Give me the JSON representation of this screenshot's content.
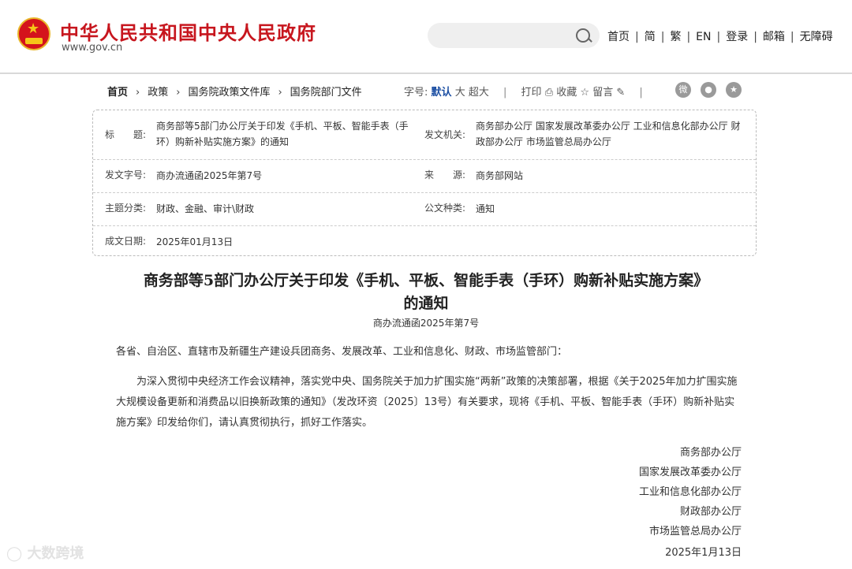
{
  "header": {
    "site_name": "中华人民共和国中央人民政府",
    "site_url": "www.gov.cn",
    "search_placeholder": "",
    "links": [
      "首页",
      "简",
      "繁",
      "EN",
      "登录",
      "邮箱",
      "无障碍"
    ]
  },
  "breadcrumb": [
    "首页",
    "政策",
    "国务院政策文件库",
    "国务院部门文件"
  ],
  "tools": {
    "font_label": "字号:",
    "font_default": "默认",
    "font_large": "大",
    "font_xlarge": "超大",
    "print": "打印",
    "collect": "收藏",
    "comment": "留言"
  },
  "info": {
    "title_label": "标　　题:",
    "title_value": "商务部等5部门办公厅关于印发《手机、平板、智能手表（手环）购新补贴实施方案》的通知",
    "issuer_label": "发文机关:",
    "issuer_value": "商务部办公厅  国家发展改革委办公厅  工业和信息化部办公厅  财政部办公厅  市场监管总局办公厅",
    "docno_label": "发文字号:",
    "docno_value": "商办流通函2025年第7号",
    "source_label": "来　　源:",
    "source_value": "商务部网站",
    "topic_label": "主题分类:",
    "topic_value": "财政、金融、审计\\财政",
    "type_label": "公文种类:",
    "type_value": "通知",
    "date_label": "成文日期:",
    "date_value": "2025年01月13日"
  },
  "document": {
    "title_line1": "商务部等5部门办公厅关于印发《手机、平板、智能手表（手环）购新补贴实施方案》",
    "title_line2": "的通知",
    "number": "商办流通函2025年第7号",
    "salutation": "各省、自治区、直辖市及新疆生产建设兵团商务、发展改革、工业和信息化、财政、市场监管部门：",
    "body": "为深入贯彻中央经济工作会议精神，落实党中央、国务院关于加力扩围实施“两新”政策的决策部署，根据《关于2025年加力扩围实施大规模设备更新和消费品以旧换新政策的通知》（发改环资〔2025〕13号）有关要求，现将《手机、平板、智能手表（手环）购新补贴实施方案》印发给你们，请认真贯彻执行，抓好工作落实。",
    "signatories": [
      "商务部办公厅",
      "国家发展改革委办公厅",
      "工业和信息化部办公厅",
      "财政部办公厅",
      "市场监管总局办公厅"
    ],
    "sign_date": "2025年1月13日"
  },
  "watermark": "大数跨境",
  "colors": {
    "brand_red": "#c7161e",
    "accent_blue": "#1c4fa3"
  }
}
